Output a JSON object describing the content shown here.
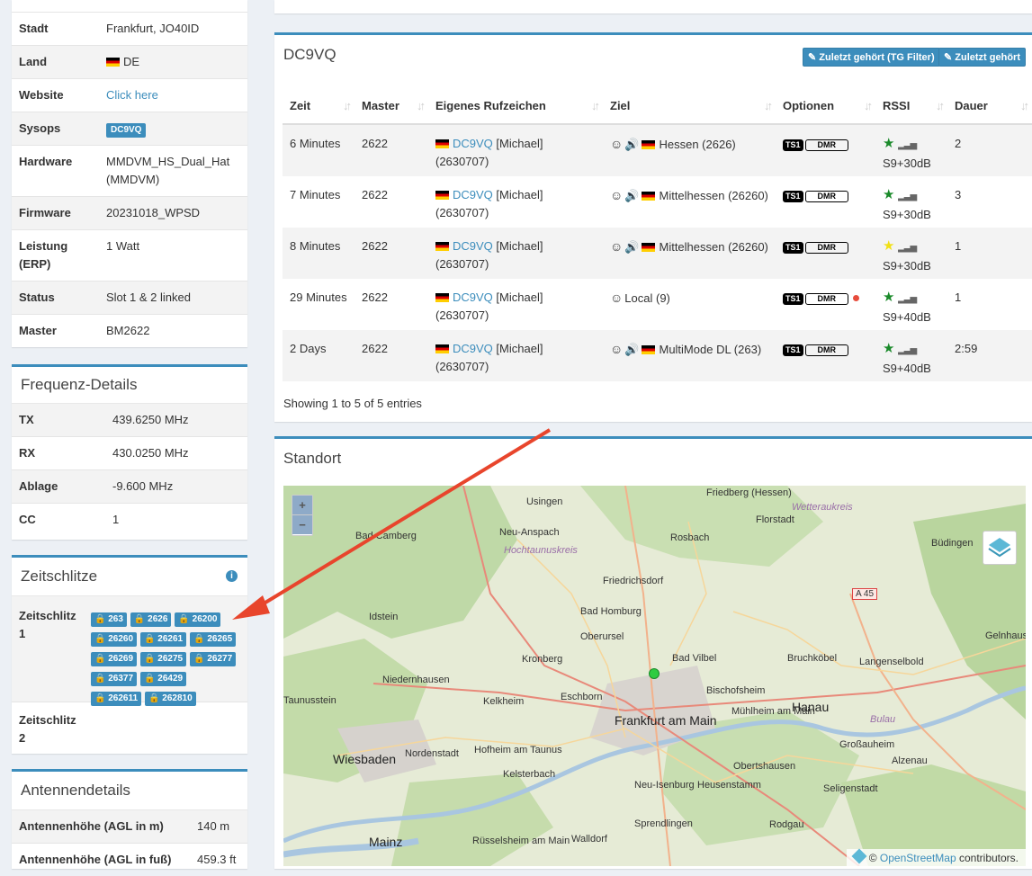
{
  "station_details": {
    "rows": [
      {
        "label": "Stadt",
        "value": "Frankfurt, JO40ID"
      },
      {
        "label": "Land",
        "value": "DE"
      },
      {
        "label": "Website",
        "value": "Click here"
      },
      {
        "label": "Sysops",
        "value": "DC9VQ"
      },
      {
        "label": "Hardware",
        "value": "MMDVM_HS_Dual_Hat (MMDVM)"
      },
      {
        "label": "Firmware",
        "value": "20231018_WPSD"
      },
      {
        "label": "Leistung (ERP)",
        "value": "1 Watt"
      },
      {
        "label": "Status",
        "value": "Slot 1 & 2 linked"
      },
      {
        "label": "Master",
        "value": "BM2622"
      }
    ]
  },
  "frequency": {
    "title": "Frequenz-Details",
    "rows": [
      {
        "label": "TX",
        "value": "439.6250 MHz"
      },
      {
        "label": "RX",
        "value": "430.0250 MHz"
      },
      {
        "label": "Ablage",
        "value": "-9.600 MHz"
      },
      {
        "label": "CC",
        "value": "1"
      }
    ]
  },
  "timeslots": {
    "title": "Zeitschlitze",
    "slot1_label": "Zeitschlitz 1",
    "slot1_tgs": [
      "263",
      "2626",
      "26200",
      "26260",
      "26261",
      "26265",
      "26269",
      "26275",
      "26277",
      "26377",
      "26429",
      "262611",
      "262810"
    ],
    "slot2_label": "Zeitschlitz 2"
  },
  "antenna": {
    "title": "Antennendetails",
    "rows": [
      {
        "label": "Antennenhöhe (AGL in m)",
        "value": "140 m"
      },
      {
        "label": "Antennenhöhe (AGL in fuß)",
        "value": "459.3 ft"
      }
    ]
  },
  "lastheard": {
    "title": "DC9VQ",
    "btn_tg_filter": "Zuletzt gehört (TG Filter)",
    "btn_last": "Zuletzt gehört",
    "headers": [
      "Zeit",
      "Master",
      "Eigenes Rufzeichen",
      "Ziel",
      "Optionen",
      "RSSI",
      "Dauer"
    ],
    "rows": [
      {
        "zeit": "6 Minutes",
        "master": "2622",
        "call": "DC9VQ",
        "name": "[Michael] (2630707)",
        "ziel": "Hessen (2626)",
        "ts": "TS1",
        "mode": "DMR",
        "rssi": "S9+30dB",
        "dauer": "2"
      },
      {
        "zeit": "7 Minutes",
        "master": "2622",
        "call": "DC9VQ",
        "name": "[Michael] (2630707)",
        "ziel": "Mittelhessen (26260)",
        "ts": "TS1",
        "mode": "DMR",
        "rssi": "S9+30dB",
        "dauer": "3"
      },
      {
        "zeit": "8 Minutes",
        "master": "2622",
        "call": "DC9VQ",
        "name": "[Michael] (2630707)",
        "ziel": "Mittelhessen (26260)",
        "ts": "TS1",
        "mode": "DMR",
        "rssi": "S9+30dB",
        "dauer": "1"
      },
      {
        "zeit": "29 Minutes",
        "master": "2622",
        "call": "DC9VQ",
        "name": "[Michael] (2630707)",
        "ziel": "Local (9)",
        "ts": "TS1",
        "mode": "DMR",
        "rssi": "S9+40dB",
        "dauer": "1"
      },
      {
        "zeit": "2 Days",
        "master": "2622",
        "call": "DC9VQ",
        "name": "[Michael] (2630707)",
        "ziel": "MultiMode DL (263)",
        "ts": "TS1",
        "mode": "DMR",
        "rssi": "S9+40dB",
        "dauer": "2:59"
      }
    ],
    "footer": "Showing 1 to 5 of 5 entries"
  },
  "location": {
    "title": "Standort",
    "zoom_in": "+",
    "zoom_out": "−",
    "attribution_prefix": "©",
    "attribution_link": "OpenStreetMap",
    "attribution_suffix": "contributors.",
    "labels": [
      "Usingen",
      "Friedberg (Hessen)",
      "Florstadt",
      "Wetteraukreis",
      "Bad Camberg",
      "Neu-Anspach",
      "Hochtaunuskreis",
      "Rosbach",
      "Büdingen",
      "Friedrichsdorf",
      "A 45",
      "Idstein",
      "Bad Homburg",
      "Gelnhausen",
      "Oberursel",
      "Kronberg",
      "Bad Vilbel",
      "Bruchköbel",
      "Langenselbold",
      "Niedernhausen",
      "Taunusstein",
      "Kelkheim",
      "Eschborn",
      "Bischofsheim",
      "Mühlheim am Main",
      "Hanau",
      "Frankfurt am Main",
      "Großauheim",
      "Hofheim am Taunus",
      "Wiesbaden",
      "Nordenstadt",
      "Kelsterbach",
      "Obertshausen",
      "Alzenau",
      "Neu-Isenburg",
      "Heusenstamm",
      "Seligenstadt",
      "Sprendlingen",
      "Rodgau",
      "Mainz",
      "Rüsselsheim am Main",
      "Walldorf",
      "Bulau"
    ]
  },
  "colors": {
    "accent": "#3c8dbc",
    "arrow": "#e8452c",
    "map_bg": "#e8ecd9"
  }
}
